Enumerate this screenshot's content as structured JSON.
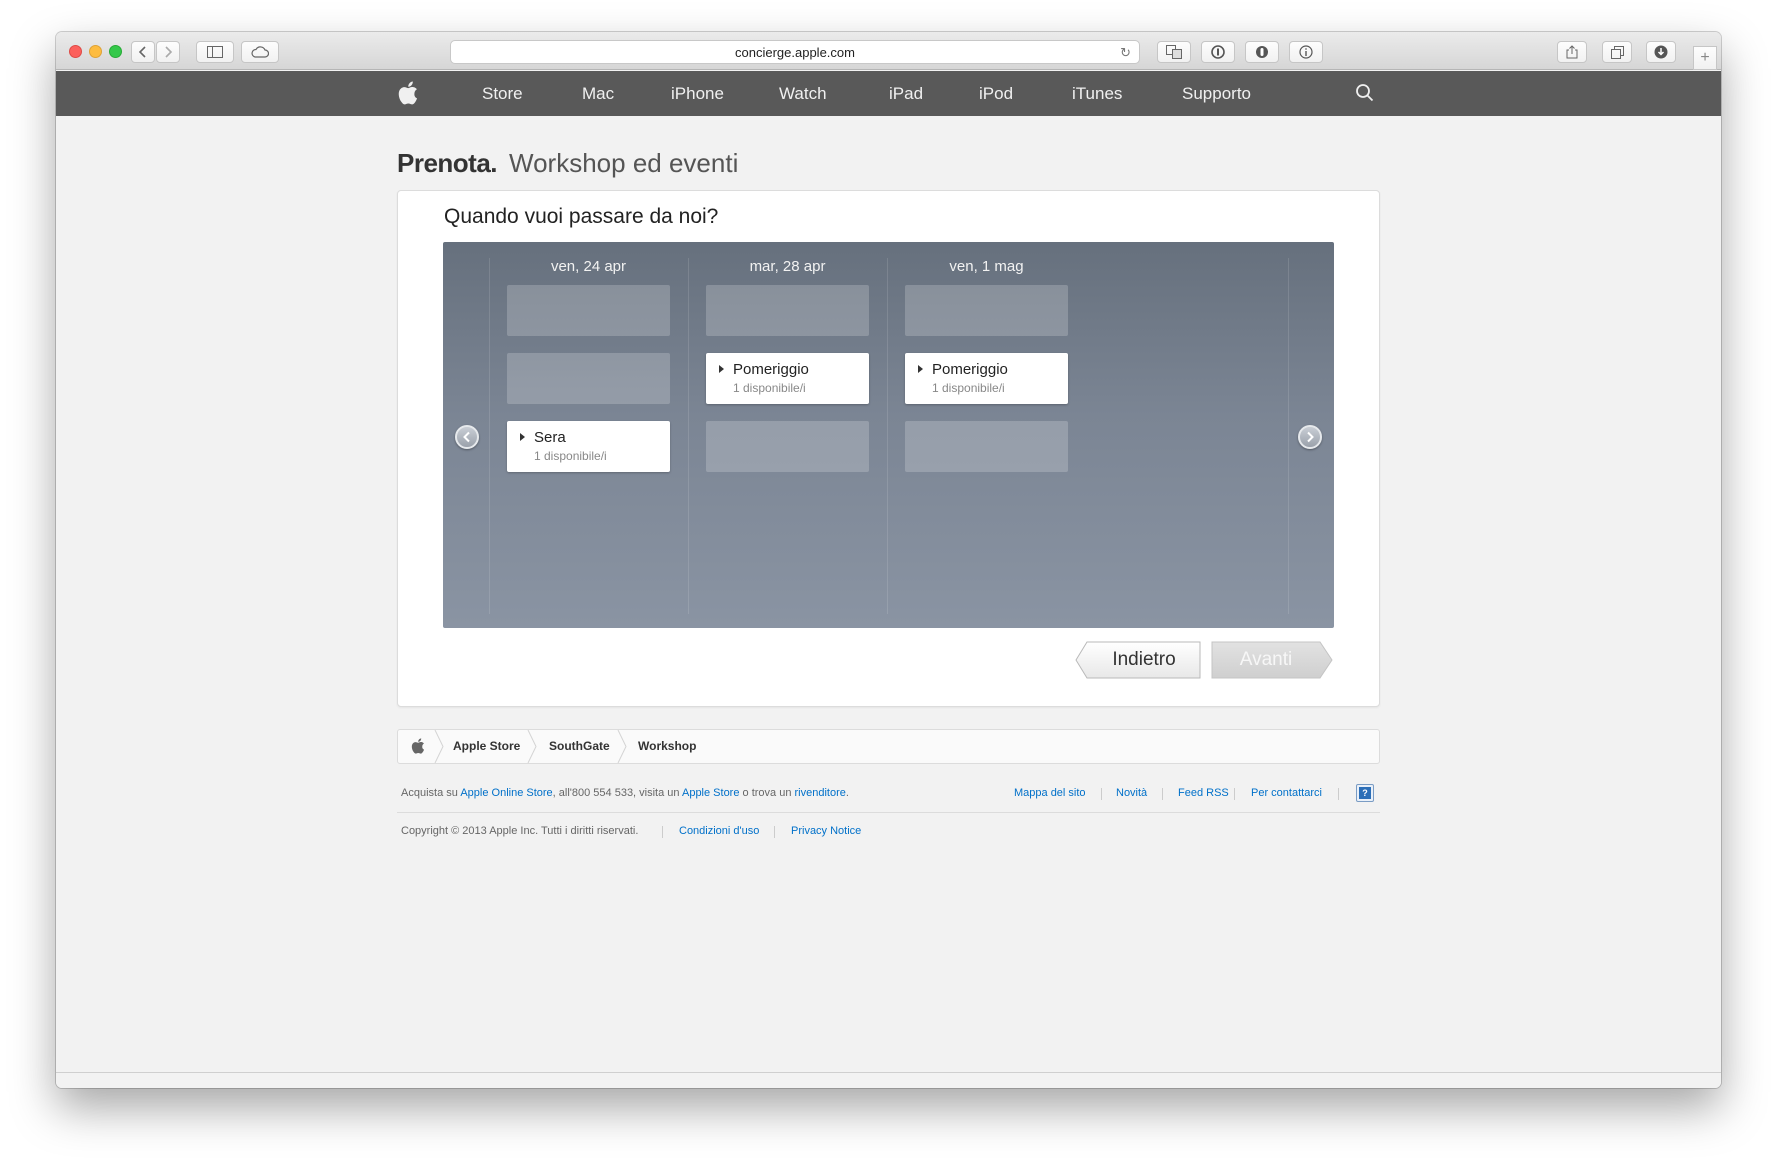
{
  "browser": {
    "url": "concierge.apple.com"
  },
  "nav": {
    "items": [
      "Store",
      "Mac",
      "iPhone",
      "Watch",
      "iPad",
      "iPod",
      "iTunes",
      "Supporto"
    ]
  },
  "page": {
    "title_strong": "Prenota.",
    "title_light": "Workshop ed eventi",
    "question": "Quando vuoi passare da noi?"
  },
  "calendar": {
    "days": [
      {
        "label": "ven, 24 apr",
        "slots": [
          {
            "name": "",
            "availability": "",
            "available": false
          },
          {
            "name": "",
            "availability": "",
            "available": false
          },
          {
            "name": "Sera",
            "availability": "1 disponibile/i",
            "available": true
          }
        ]
      },
      {
        "label": "mar, 28 apr",
        "slots": [
          {
            "name": "",
            "availability": "",
            "available": false
          },
          {
            "name": "Pomeriggio",
            "availability": "1 disponibile/i",
            "available": true
          },
          {
            "name": "",
            "availability": "",
            "available": false
          }
        ]
      },
      {
        "label": "ven, 1 mag",
        "slots": [
          {
            "name": "",
            "availability": "",
            "available": false
          },
          {
            "name": "Pomeriggio",
            "availability": "1 disponibile/i",
            "available": true
          },
          {
            "name": "",
            "availability": "",
            "available": false
          }
        ]
      }
    ]
  },
  "buttons": {
    "back": "Indietro",
    "next": "Avanti"
  },
  "breadcrumb": {
    "items": [
      "Apple Store",
      "SouthGate",
      "Workshop"
    ]
  },
  "footer": {
    "shop_prefix": "Acquista su ",
    "shop_link1": "Apple Online Store",
    "shop_mid": ", all'800 554 533, visita un ",
    "shop_link2": "Apple Store",
    "shop_mid2": " o trova un ",
    "shop_link3": "rivenditore",
    "shop_suffix": ".",
    "links": [
      "Mappa del sito",
      "Novità",
      "Feed RSS",
      "Per contattarci"
    ],
    "copyright": "Copyright © 2013 Apple Inc. Tutti i diritti riservati.",
    "legal_links": [
      "Condizioni d'uso",
      "Privacy Notice"
    ]
  },
  "colors": {
    "nav_bg": "#595959",
    "link": "#0070c9",
    "calendar_bg": "#7b8594"
  }
}
